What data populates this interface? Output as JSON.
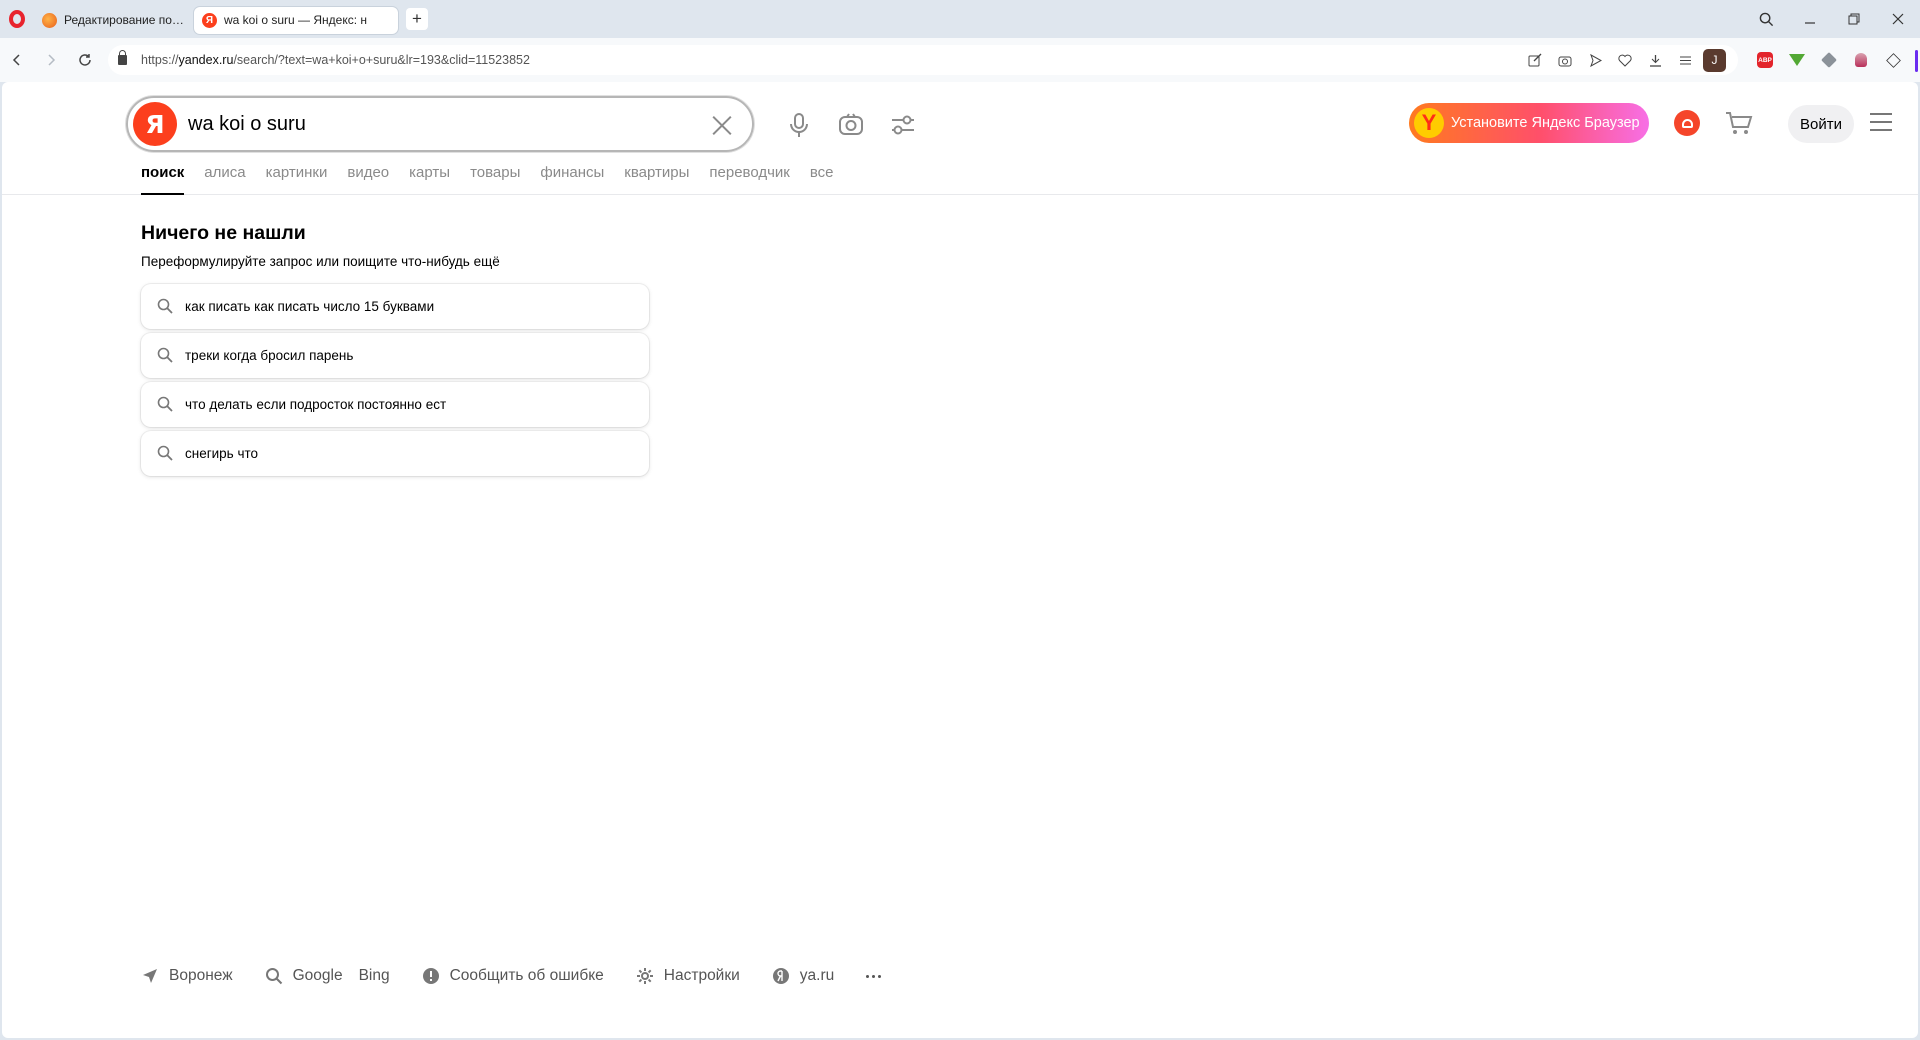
{
  "browser": {
    "tabs": [
      {
        "title": "Редактирование поста",
        "active": false
      },
      {
        "title": "wa koi o suru — Яндекс: н",
        "active": true
      }
    ],
    "address": {
      "prefix": "https://",
      "host": "yandex.ru",
      "path": "/search/?text=wa+koi+o+suru&lr=193&clid=11523852"
    },
    "profile_initial": "J",
    "abp_label": "ABP"
  },
  "header": {
    "logo_letter": "Я",
    "search_value": "wa koi o suru",
    "install_label": "Установите Яндекс Браузер",
    "install_logo": "Y",
    "login_label": "Войти"
  },
  "search_tabs": [
    {
      "label": "поиск",
      "active": true
    },
    {
      "label": "алиса"
    },
    {
      "label": "картинки"
    },
    {
      "label": "видео"
    },
    {
      "label": "карты"
    },
    {
      "label": "товары"
    },
    {
      "label": "финансы"
    },
    {
      "label": "квартиры"
    },
    {
      "label": "переводчик"
    },
    {
      "label": "все"
    }
  ],
  "no_results": {
    "title": "Ничего не нашли",
    "subtitle": "Переформулируйте запрос или поищите что-нибудь ещё"
  },
  "suggestions": [
    "как писать как писать число 15 буквами",
    "треки когда бросил парень",
    "что делать если подросток постоянно ест",
    "снегирь что"
  ],
  "footer": {
    "region": "Воронеж",
    "google": "Google",
    "bing": "Bing",
    "report": "Сообщить об ошибке",
    "settings": "Настройки",
    "yaru": "ya.ru"
  },
  "colors": {
    "yandex_red": "#fc3f1d",
    "install_gradient_start": "#ff7a1f",
    "install_gradient_end": "#f76fe6"
  }
}
